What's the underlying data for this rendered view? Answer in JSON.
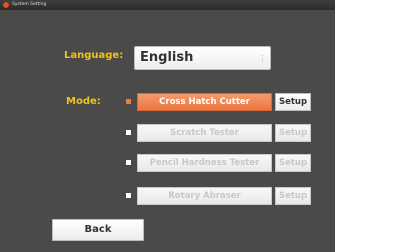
{
  "window": {
    "title": "System Setting"
  },
  "language": {
    "label": "Language:",
    "selected": "English"
  },
  "mode": {
    "label": "Mode:",
    "options": [
      {
        "label": "Cross Hatch Cutter",
        "selected": true,
        "setup_label": "Setup",
        "enabled": true
      },
      {
        "label": "Scratch Tester",
        "selected": false,
        "setup_label": "Setup",
        "enabled": false
      },
      {
        "label": "Pencil Hardness Tester",
        "selected": false,
        "setup_label": "Setup",
        "enabled": false
      },
      {
        "label": "Rotary Abraser",
        "selected": false,
        "setup_label": "Setup",
        "enabled": false
      }
    ]
  },
  "footer": {
    "back_label": "Back"
  },
  "colors": {
    "background": "#4a4a48",
    "label_accent": "#f0c419",
    "selected_button": "#ec7842",
    "close_button": "#e2572c"
  }
}
